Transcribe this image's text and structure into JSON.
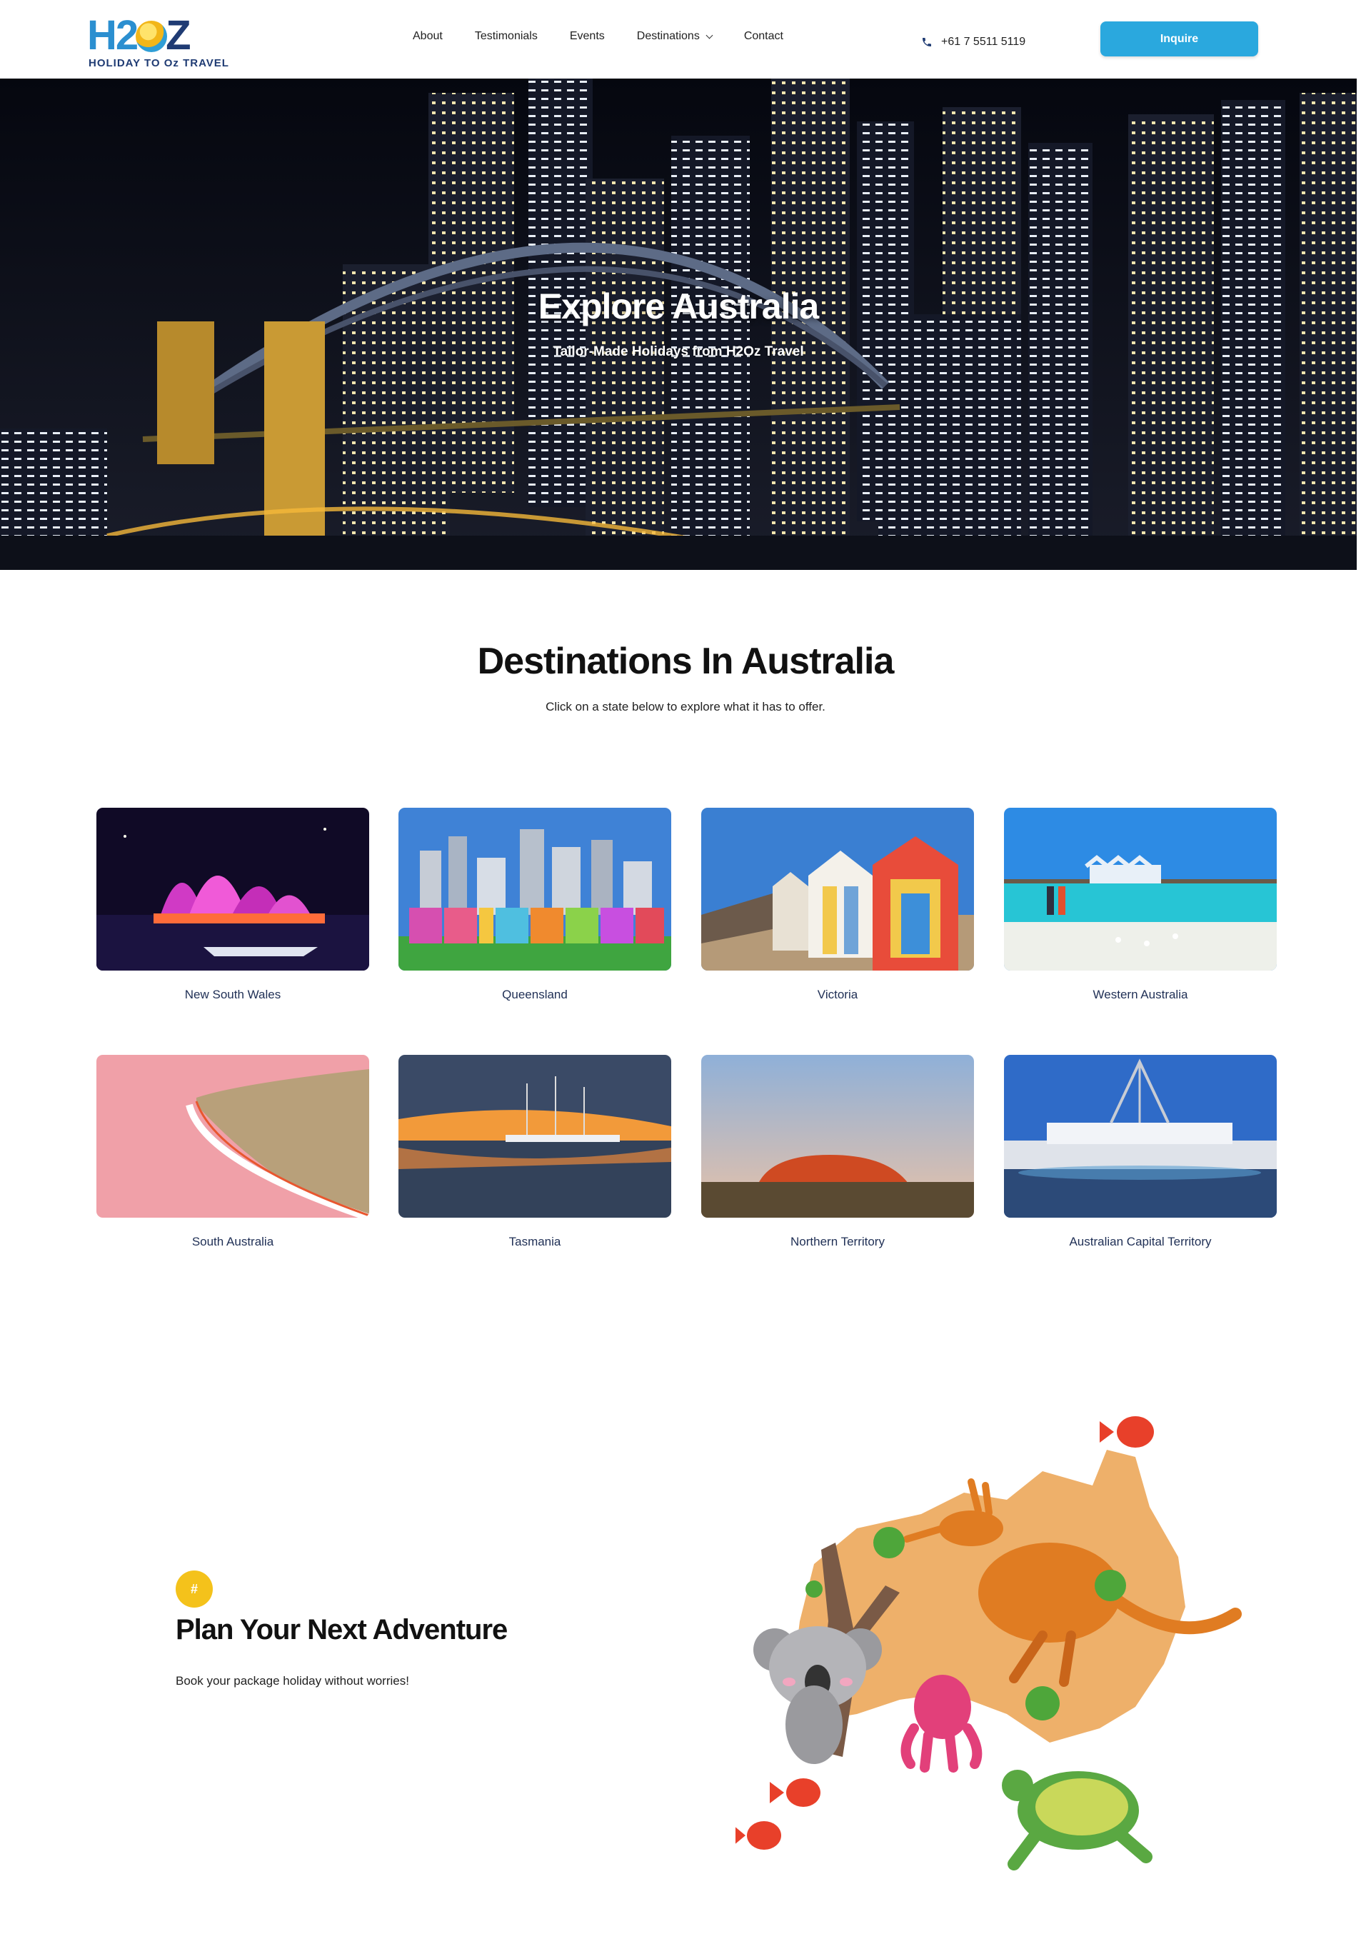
{
  "brand": {
    "logo_text": "H2OZ",
    "tagline": "HOLIDAY TO Oz TRAVEL"
  },
  "nav": {
    "items": [
      {
        "label": "About"
      },
      {
        "label": "Testimonials"
      },
      {
        "label": "Events"
      },
      {
        "label": "Destinations",
        "has_dropdown": true
      },
      {
        "label": "Contact"
      }
    ]
  },
  "header": {
    "phone": "+61 7 5511 5119",
    "inquire_label": "Inquire"
  },
  "hero": {
    "title": "Explore Australia",
    "subtitle": "Tailor-Made Holidays from H2Oz Travel"
  },
  "destinations": {
    "title": "Destinations In Australia",
    "subtitle": "Click on a state below to explore what it has to offer.",
    "states": [
      {
        "name": "New South Wales"
      },
      {
        "name": "Queensland"
      },
      {
        "name": "Victoria"
      },
      {
        "name": "Western Australia"
      },
      {
        "name": "South Australia"
      },
      {
        "name": "Tasmania"
      },
      {
        "name": "Northern Territory"
      },
      {
        "name": "Australian Capital Territory"
      }
    ]
  },
  "plan": {
    "badge": "#",
    "title": "Plan Your Next Adventure",
    "subtitle": "Book your package holiday without worries!"
  },
  "colors": {
    "accent": "#2aa8de",
    "badge": "#f4c21b",
    "brand_navy": "#1f3b73"
  }
}
